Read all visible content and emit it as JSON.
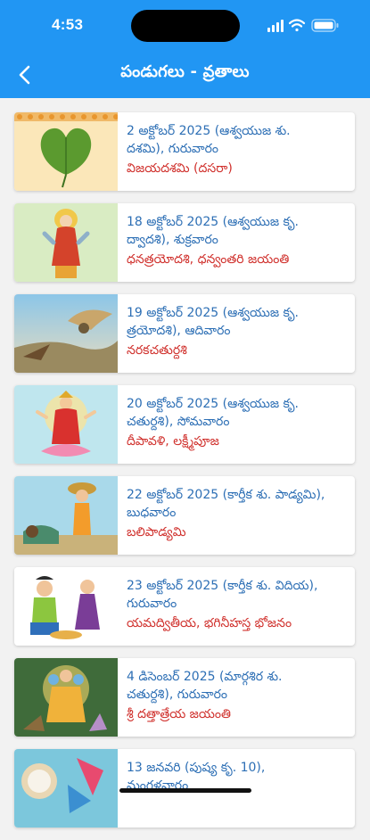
{
  "status": {
    "time": "4:53"
  },
  "header": {
    "title": "పండుగలు - వ్రతాలు",
    "back_icon": "chevron-left-icon"
  },
  "festivals": [
    {
      "date_line1": "2 అక్టోబర్ 2025 (ఆశ్వయుజ శు.",
      "date_line2": "దశమి), గురువారం",
      "name": "విజయదశమి (దసరా)",
      "image": "leaf-image"
    },
    {
      "date_line1": "18 అక్టోబర్ 2025 (ఆశ్వయుజ కృ.",
      "date_line2": "ద్వాదశి), శుక్రవారం",
      "name": "ధనత్రయోదశి, ధన్వంతరి జయంతి",
      "image": "dhanvantari-image"
    },
    {
      "date_line1": "19 అక్టోబర్ 2025 (ఆశ్వయుజ కృ.",
      "date_line2": "త్రయోదశి), ఆదివారం",
      "name": "నరకచతుర్దశి",
      "image": "battle-image"
    },
    {
      "date_line1": "20 అక్టోబర్ 2025 (ఆశ్వయుజ కృ.",
      "date_line2": "చతుర్దశి), సోమవారం",
      "name": "దీపావళి, లక్ష్మీపూజ",
      "image": "lakshmi-image"
    },
    {
      "date_line1": "22 అక్టోబర్ 2025 (కార్తీక శు. పాడ్యమి),",
      "date_line2": "బుధవారం",
      "name": "బలిపాడ్యమి",
      "image": "bali-image"
    },
    {
      "date_line1": "23 అక్టోబర్ 2025 (కార్తీక శు. విదియ),",
      "date_line2": "గురువారం",
      "name": "యమద్వితీయ,  భగినీహస్త భోజనం",
      "image": "siblings-image"
    },
    {
      "date_line1": "4 డిసెంబర్ 2025 (మార్గశిర శు.",
      "date_line2": "చతుర్దశి), గురువారం",
      "name": "శ్రీ దత్తాత్రేయ జయంతి",
      "image": "dattatreya-image"
    },
    {
      "date_line1": "13 జనవరి (పుష్య కృ. 10),",
      "date_line2": "మంగళవారం",
      "name": "",
      "image": "bhogi-image"
    }
  ],
  "colors": {
    "header": "#2196f3",
    "date_text": "#2d6fb5",
    "festival_text": "#d0312d"
  }
}
